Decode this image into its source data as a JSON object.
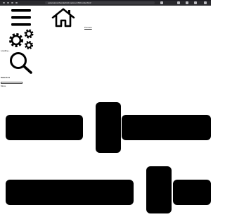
{
  "browser": {
    "url": "extensions.thunderbird.net/en-US/thunderbird/"
  },
  "header": {
    "menu_icon": "hamburger-menu-icon",
    "home_icon": "home-icon",
    "settings_icon": "gears-icon",
    "search_icon": "magnifier-icon",
    "preview_link": "Preview"
  },
  "status": {
    "loading_text": "Loading..."
  },
  "search": {
    "label": "Search &",
    "field_label": "Move"
  },
  "sliders": [
    {
      "name": "slider-1",
      "level": 0.44
    },
    {
      "name": "slider-2",
      "level": 0.78
    }
  ],
  "colors": {
    "toolbar": "#2a2a2e",
    "icon": "#000000",
    "page": "#ffffff"
  }
}
